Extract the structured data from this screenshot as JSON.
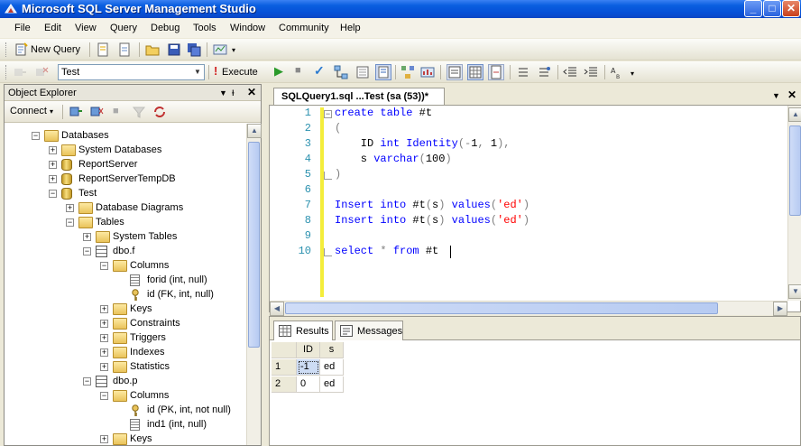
{
  "window": {
    "title": "Microsoft SQL Server Management Studio",
    "controls": [
      "_",
      "□",
      "✕"
    ]
  },
  "menu": [
    "File",
    "Edit",
    "View",
    "Query",
    "Debug",
    "Tools",
    "Window",
    "Community",
    "Help"
  ],
  "toolbar1": {
    "new_query_label": "New Query"
  },
  "toolbar2": {
    "database": "Test",
    "execute_label": "Execute"
  },
  "object_explorer": {
    "title": "Object Explorer",
    "connect_label": "Connect",
    "tree": [
      {
        "label": "Databases",
        "expander": "−",
        "icon": "folder",
        "depth": 0
      },
      {
        "label": "System Databases",
        "expander": "+",
        "icon": "folder",
        "depth": 1
      },
      {
        "label": "ReportServer",
        "expander": "+",
        "icon": "database",
        "depth": 1
      },
      {
        "label": "ReportServerTempDB",
        "expander": "+",
        "icon": "database",
        "depth": 1
      },
      {
        "label": "Test",
        "expander": "−",
        "icon": "database",
        "depth": 1
      },
      {
        "label": "Database Diagrams",
        "expander": "+",
        "icon": "folder",
        "depth": 2
      },
      {
        "label": "Tables",
        "expander": "−",
        "icon": "folder",
        "depth": 2
      },
      {
        "label": "System Tables",
        "expander": "+",
        "icon": "folder",
        "depth": 3
      },
      {
        "label": "dbo.f",
        "expander": "−",
        "icon": "table",
        "depth": 3
      },
      {
        "label": "Columns",
        "expander": "−",
        "icon": "folder",
        "depth": 4
      },
      {
        "label": "forid (int, null)",
        "expander": "",
        "icon": "column",
        "depth": 5
      },
      {
        "label": "id (FK, int, null)",
        "expander": "",
        "icon": "key",
        "depth": 5
      },
      {
        "label": "Keys",
        "expander": "+",
        "icon": "folder",
        "depth": 4
      },
      {
        "label": "Constraints",
        "expander": "+",
        "icon": "folder",
        "depth": 4
      },
      {
        "label": "Triggers",
        "expander": "+",
        "icon": "folder",
        "depth": 4
      },
      {
        "label": "Indexes",
        "expander": "+",
        "icon": "folder",
        "depth": 4
      },
      {
        "label": "Statistics",
        "expander": "+",
        "icon": "folder",
        "depth": 4
      },
      {
        "label": "dbo.p",
        "expander": "−",
        "icon": "table",
        "depth": 3
      },
      {
        "label": "Columns",
        "expander": "−",
        "icon": "folder",
        "depth": 4
      },
      {
        "label": "id (PK, int, not null)",
        "expander": "",
        "icon": "key",
        "depth": 5
      },
      {
        "label": "ind1 (int, null)",
        "expander": "",
        "icon": "column",
        "depth": 5
      },
      {
        "label": "Keys",
        "expander": "+",
        "icon": "folder",
        "depth": 4
      }
    ]
  },
  "editor": {
    "tab_title": "SQLQuery1.sql ...Test (sa (53))*",
    "lines": [
      {
        "no": "1",
        "tokens": [
          {
            "t": "create",
            "c": "kw"
          },
          {
            "t": " ",
            "c": ""
          },
          {
            "t": "table",
            "c": "kw"
          },
          {
            "t": " #t",
            "c": ""
          }
        ]
      },
      {
        "no": "2",
        "tokens": [
          {
            "t": "(",
            "c": "pn"
          }
        ]
      },
      {
        "no": "3",
        "tokens": [
          {
            "t": "    ID ",
            "c": ""
          },
          {
            "t": "int",
            "c": "kw"
          },
          {
            "t": " ",
            "c": ""
          },
          {
            "t": "Identity",
            "c": "kw"
          },
          {
            "t": "(",
            "c": "pn"
          },
          {
            "t": "-",
            "c": "pn"
          },
          {
            "t": "1",
            "c": ""
          },
          {
            "t": ",",
            "c": "pn"
          },
          {
            "t": " 1",
            "c": ""
          },
          {
            "t": "),",
            "c": "pn"
          }
        ]
      },
      {
        "no": "4",
        "tokens": [
          {
            "t": "    s ",
            "c": ""
          },
          {
            "t": "varchar",
            "c": "kw"
          },
          {
            "t": "(",
            "c": "pn"
          },
          {
            "t": "100",
            "c": ""
          },
          {
            "t": ")",
            "c": "pn"
          }
        ]
      },
      {
        "no": "5",
        "tokens": [
          {
            "t": ")",
            "c": "pn"
          }
        ]
      },
      {
        "no": "6",
        "tokens": []
      },
      {
        "no": "7",
        "tokens": [
          {
            "t": "Insert",
            "c": "kw"
          },
          {
            "t": " ",
            "c": ""
          },
          {
            "t": "into",
            "c": "kw"
          },
          {
            "t": " #t",
            "c": ""
          },
          {
            "t": "(",
            "c": "pn"
          },
          {
            "t": "s",
            "c": ""
          },
          {
            "t": ")",
            "c": "pn"
          },
          {
            "t": " ",
            "c": ""
          },
          {
            "t": "values",
            "c": "kw"
          },
          {
            "t": "(",
            "c": "pn"
          },
          {
            "t": "'ed'",
            "c": "str"
          },
          {
            "t": ")",
            "c": "pn"
          }
        ]
      },
      {
        "no": "8",
        "tokens": [
          {
            "t": "Insert",
            "c": "kw"
          },
          {
            "t": " ",
            "c": ""
          },
          {
            "t": "into",
            "c": "kw"
          },
          {
            "t": " #t",
            "c": ""
          },
          {
            "t": "(",
            "c": "pn"
          },
          {
            "t": "s",
            "c": ""
          },
          {
            "t": ")",
            "c": "pn"
          },
          {
            "t": " ",
            "c": ""
          },
          {
            "t": "values",
            "c": "kw"
          },
          {
            "t": "(",
            "c": "pn"
          },
          {
            "t": "'ed'",
            "c": "str"
          },
          {
            "t": ")",
            "c": "pn"
          }
        ]
      },
      {
        "no": "9",
        "tokens": []
      },
      {
        "no": "10",
        "tokens": [
          {
            "t": "select",
            "c": "kw"
          },
          {
            "t": " ",
            "c": ""
          },
          {
            "t": "*",
            "c": "pn"
          },
          {
            "t": " ",
            "c": ""
          },
          {
            "t": "from",
            "c": "kw"
          },
          {
            "t": " #t",
            "c": ""
          }
        ]
      }
    ]
  },
  "results": {
    "tabs": [
      "Results",
      "Messages"
    ],
    "columns": [
      "ID",
      "s"
    ],
    "rows": [
      {
        "n": "1",
        "cells": [
          "-1",
          "ed"
        ]
      },
      {
        "n": "2",
        "cells": [
          "0",
          "ed"
        ]
      }
    ]
  },
  "colors": {
    "title_blue": "#0550d8",
    "keyword": "#0000ff",
    "string": "#ff0000",
    "line_number": "#2b91af",
    "change_bar": "#f4ed3b"
  }
}
